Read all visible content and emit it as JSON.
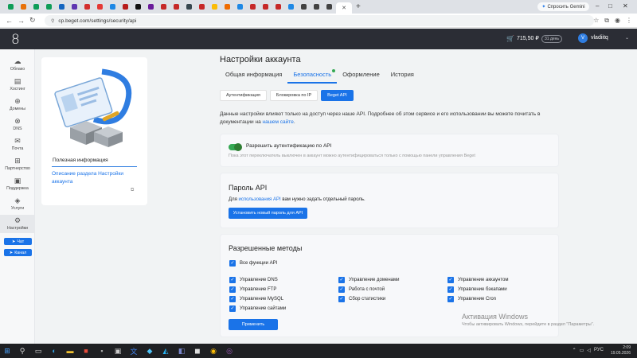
{
  "browser": {
    "tabs": [
      {
        "icon": "sheets-icon",
        "color": "#0f9d58"
      },
      {
        "icon": "site-icon",
        "color": "#e8710a"
      },
      {
        "icon": "sheets-icon",
        "color": "#0f9d58"
      },
      {
        "icon": "sheets-icon",
        "color": "#0f9d58"
      },
      {
        "icon": "w-icon",
        "color": "#1565c0"
      },
      {
        "icon": "site-icon",
        "color": "#5e35b1"
      },
      {
        "icon": "site-icon",
        "color": "#d32f2f"
      },
      {
        "icon": "site-icon",
        "color": "#e53935"
      },
      {
        "icon": "site-icon",
        "color": "#1e88e5"
      },
      {
        "icon": "site-icon",
        "color": "#b71c1c"
      },
      {
        "icon": "x-icon",
        "color": "#111111"
      },
      {
        "icon": "site-icon",
        "color": "#6a1b9a"
      },
      {
        "icon": "gmail-icon",
        "color": "#c62828"
      },
      {
        "icon": "gmail-icon",
        "color": "#c62828"
      },
      {
        "icon": "site-icon",
        "color": "#37474f"
      },
      {
        "icon": "site-icon",
        "color": "#c62828"
      },
      {
        "icon": "site-icon",
        "color": "#fbbc05"
      },
      {
        "icon": "site-icon",
        "color": "#ef6c00"
      },
      {
        "icon": "site-icon",
        "color": "#1e88e5"
      },
      {
        "icon": "gmail-icon",
        "color": "#c62828"
      },
      {
        "icon": "gmail-icon",
        "color": "#c62828"
      },
      {
        "icon": "gmail-icon",
        "color": "#c62828"
      },
      {
        "icon": "site-icon",
        "color": "#1e88e5"
      },
      {
        "icon": "site-icon",
        "color": "#424242"
      },
      {
        "icon": "site-icon",
        "color": "#424242"
      },
      {
        "icon": "site-icon",
        "color": "#424242"
      },
      {
        "icon": "close-icon",
        "color": "#555555"
      }
    ],
    "gemini_label": "Спросить Gemini",
    "url": "cp.beget.com/settings/security/api"
  },
  "header": {
    "logo": "8",
    "balance": "715,50 ₽",
    "days": "31 день",
    "avatar_letter": "V",
    "username": "vladiitq"
  },
  "sidebar": {
    "items": [
      {
        "label": "Облако",
        "icon": "cloud-icon"
      },
      {
        "label": "Хостинг",
        "icon": "server-icon"
      },
      {
        "label": "Домены",
        "icon": "globe-icon"
      },
      {
        "label": "DNS",
        "icon": "dns-icon"
      },
      {
        "label": "Почта",
        "icon": "mail-icon"
      },
      {
        "label": "Партнерство",
        "icon": "partners-icon"
      },
      {
        "label": "Поддержка",
        "icon": "support-icon"
      },
      {
        "label": "Услуги",
        "icon": "services-icon"
      },
      {
        "label": "Настройки",
        "icon": "settings-icon"
      }
    ],
    "chat_label": "Чат",
    "channel_label": "Канал"
  },
  "info": {
    "title": "Полезная информация",
    "link": "Описание раздела Настройки аккаунта"
  },
  "page": {
    "title": "Настройки аккаунта",
    "tabs": [
      "Общая информация",
      "Безопасность",
      "Оформление",
      "История"
    ],
    "subtabs": [
      "Аутентификация",
      "Блокировка по IP",
      "Beget API"
    ],
    "desc_part1": "Данные настройки влияют только на доступ через наше API. Подробнее об этом сервисе и его использовании вы можете почитать в документации на ",
    "desc_link": "нашем сайте",
    "desc_part2": "."
  },
  "auth_card": {
    "label": "Разрешить аутентификацию по API",
    "hint": "Пока этот переключатель выключен в аккаунт можно аутентифицироваться только с помощью панели управления Beget"
  },
  "password_card": {
    "title": "Пароль API",
    "text_before": "Для ",
    "text_link": "использования API",
    "text_after": " вам нужно задать отдельный пароль.",
    "button": "Установить новый пароль для API"
  },
  "methods_card": {
    "title": "Разрешенные методы",
    "all_label": "Все функции API",
    "col1": [
      "Управление DNS",
      "Управление FTP",
      "Управление MySQL",
      "Управление сайтами"
    ],
    "col2": [
      "Управление доменами",
      "Работа с почтой",
      "Сбор статистики"
    ],
    "col3": [
      "Управление аккаунтом",
      "Управление бэкапами",
      "Управление Cron"
    ],
    "apply": "Применить"
  },
  "watermark": {
    "line1": "Активация Windows",
    "line2": "Чтобы активировать Windows, перейдите в раздел \"Параметры\"."
  },
  "taskbar": {
    "lang": "РУС",
    "time": "2:09",
    "date": "19.05.2026"
  }
}
